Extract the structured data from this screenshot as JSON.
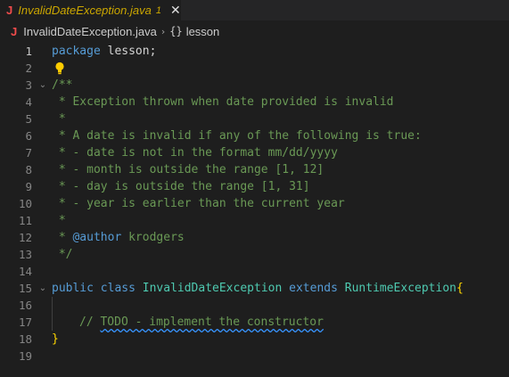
{
  "tab": {
    "icon": "J",
    "filename": "InvalidDateException.java",
    "problems_count": "1",
    "close_glyph": "✕"
  },
  "breadcrumbs": {
    "file_icon": "J",
    "file": "InvalidDateException.java",
    "separator": "›",
    "package_icon": "{}",
    "package": "lesson"
  },
  "editor": {
    "line_numbers": [
      "1",
      "2",
      "3",
      "4",
      "5",
      "6",
      "7",
      "8",
      "9",
      "10",
      "11",
      "12",
      "13",
      "14",
      "15",
      "16",
      "17",
      "18",
      "19"
    ],
    "lines": {
      "l1_kw": "package",
      "l1_name": "lesson",
      "l1_end": ";",
      "l3": "/**",
      "l4": " * Exception thrown when date provided is invalid",
      "l5": " *",
      "l6": " * A date is invalid if any of the following is true:",
      "l7": " * - date is not in the format mm/dd/yyyy",
      "l8": " * - month is outside the range [1, 12]",
      "l9": " * - day is outside the range [1, 31]",
      "l10": " * - year is earlier than the current year",
      "l11": " *",
      "l12_pre": " * ",
      "l12_tag": "@author",
      "l12_post": " krodgers",
      "l13": " */",
      "l15_public": "public",
      "l15_class": "class",
      "l15_name": "InvalidDateException",
      "l15_extends": "extends",
      "l15_super": "RuntimeException",
      "l15_brace": "{",
      "l17_pre": "// ",
      "l17_todo": "TODO - implement the constructor",
      "l18": "}"
    }
  },
  "colors": {
    "background": "#1e1e1e",
    "keyword": "#569cd6",
    "type": "#4ec9b0",
    "comment": "#6a9955",
    "brace": "#ffd700",
    "tab_modified": "#cca700",
    "java_icon": "#f14c4c",
    "lightbulb": "#ffcc00"
  }
}
